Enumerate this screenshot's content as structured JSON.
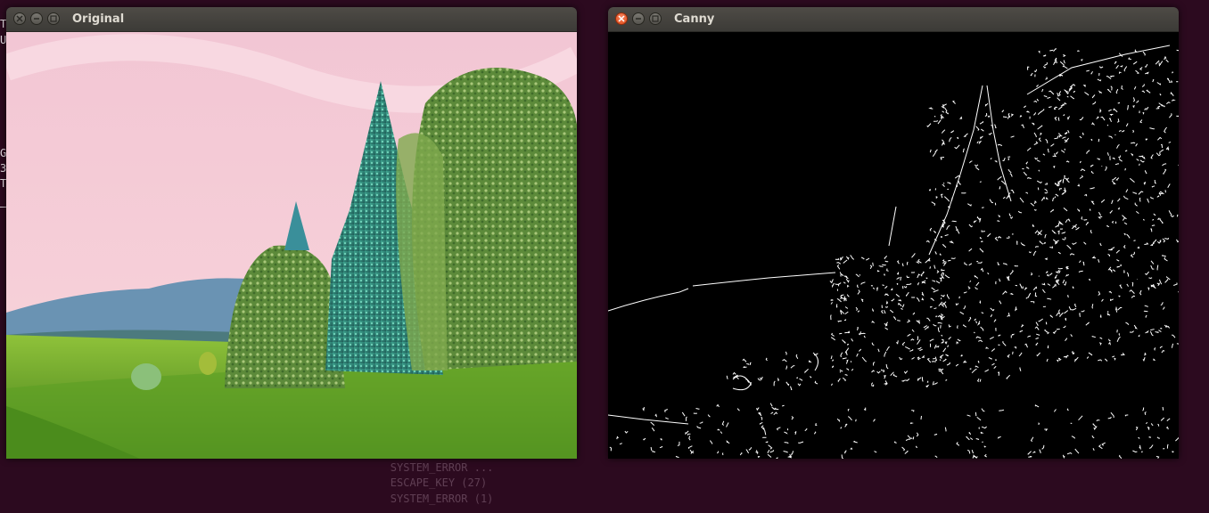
{
  "desktop": {
    "terminal_lines": [
      "        SYSTEM_ERROR ...",
      "        ESCAPE_KEY (27)",
      "        SYSTEM_ERROR (1)"
    ],
    "edge_chars": [
      "T",
      "U",
      "G",
      "3",
      "T"
    ]
  },
  "windows": {
    "original": {
      "title": "Original",
      "image_description": "forest"
    },
    "canny": {
      "title": "Canny",
      "image_description": "edges"
    }
  },
  "colors": {
    "desktop_bg": "#2c0a1f",
    "titlebar": "#3c3b37",
    "close_active": "#df4a16"
  }
}
